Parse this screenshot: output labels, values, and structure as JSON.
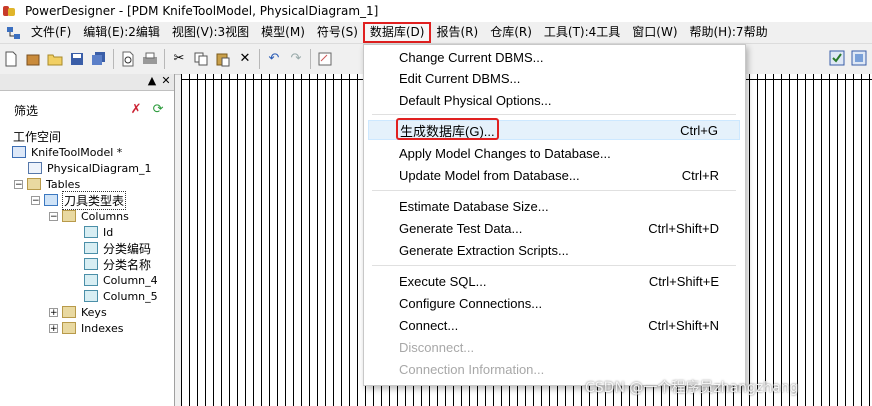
{
  "window": {
    "title": "PowerDesigner - [PDM KnifeToolModel, PhysicalDiagram_1]"
  },
  "menubar": {
    "items": [
      {
        "label": "文件(F)"
      },
      {
        "label": "编辑(E):2编辑"
      },
      {
        "label": "视图(V):3视图"
      },
      {
        "label": "模型(M)"
      },
      {
        "label": "符号(S)"
      },
      {
        "label": "数据库(D)"
      },
      {
        "label": "报告(R)"
      },
      {
        "label": "仓库(R)"
      },
      {
        "label": "工具(T):4工具"
      },
      {
        "label": "窗口(W)"
      },
      {
        "label": "帮助(H):7帮助"
      }
    ]
  },
  "toolbar": {
    "icons": [
      "new-icon",
      "open-model-icon",
      "open-folder-icon",
      "save-icon",
      "save-all-icon",
      "print-preview-icon",
      "print-icon",
      "cut-icon",
      "copy-icon",
      "paste-icon",
      "delete-icon",
      "undo-icon",
      "redo-icon",
      "properties-icon"
    ]
  },
  "browser": {
    "filter_label": "筛选",
    "tree": {
      "workspace": "工作空间",
      "model": "KnifeToolModel *",
      "diagram": "PhysicalDiagram_1",
      "tables": "Tables",
      "table": "刀具类型表",
      "columns": "Columns",
      "column_items": [
        "Id",
        "分类编码",
        "分类名称",
        "Column_4",
        "Column_5"
      ],
      "keys": "Keys",
      "indexes": "Indexes"
    }
  },
  "dropdown": {
    "items": [
      {
        "label": "Change Current DBMS...",
        "shortcut": ""
      },
      {
        "label": "Edit Current DBMS...",
        "shortcut": ""
      },
      {
        "label": "Default Physical Options...",
        "shortcut": ""
      },
      {
        "label": "生成数据库(G)...",
        "shortcut": "Ctrl+G"
      },
      {
        "label": "Apply Model Changes to Database...",
        "shortcut": ""
      },
      {
        "label": "Update Model from Database...",
        "shortcut": "Ctrl+R"
      },
      {
        "label": "Estimate Database Size...",
        "shortcut": ""
      },
      {
        "label": "Generate Test Data...",
        "shortcut": "Ctrl+Shift+D"
      },
      {
        "label": "Generate Extraction Scripts...",
        "shortcut": ""
      },
      {
        "label": "Execute SQL...",
        "shortcut": "Ctrl+Shift+E"
      },
      {
        "label": "Configure Connections...",
        "shortcut": ""
      },
      {
        "label": "Connect...",
        "shortcut": "Ctrl+Shift+N"
      },
      {
        "label": "Disconnect...",
        "shortcut": ""
      },
      {
        "label": "Connection Information...",
        "shortcut": ""
      }
    ]
  },
  "watermark": "CSDN @一个程序员zhangzhang",
  "colors": {
    "highlight_outline": "#e02020",
    "hover_bg": "#e5f1fb"
  }
}
